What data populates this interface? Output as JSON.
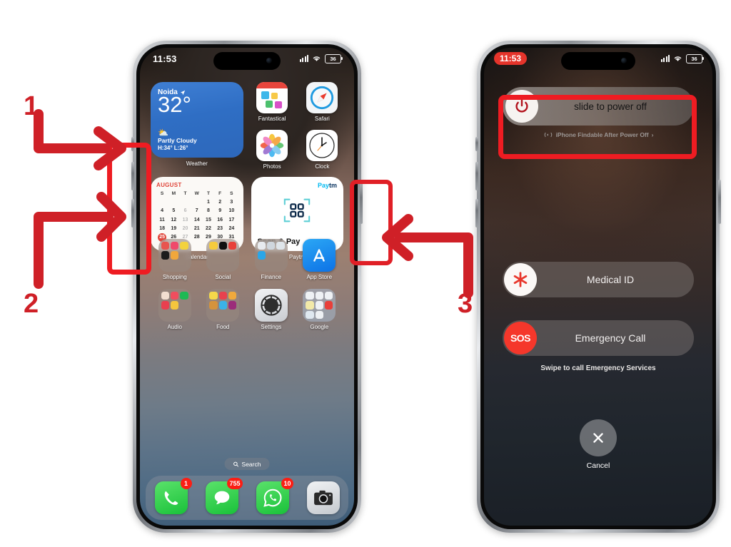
{
  "annotations": {
    "steps": [
      {
        "num": "1",
        "target": "volume-up-button"
      },
      {
        "num": "2",
        "target": "volume-down-button"
      },
      {
        "num": "3",
        "target": "side-power-button"
      }
    ]
  },
  "left_phone": {
    "status_bar": {
      "time": "11:53",
      "cellular": "signal-bars-icon",
      "wifi": "wifi-icon",
      "battery": "36"
    },
    "weather_widget": {
      "city": "Noida",
      "location_icon": "location-arrow-icon",
      "temperature": "32°",
      "condition_icon": "partly-cloudy-icon",
      "condition": "Partly Cloudy",
      "high_low": "H:34° L:26°",
      "caption": "Weather"
    },
    "top_apps": [
      {
        "label": "Fantastical",
        "icon": "fantastical-icon"
      },
      {
        "label": "Safari",
        "icon": "safari-icon"
      },
      {
        "label": "Photos",
        "icon": "photos-icon"
      },
      {
        "label": "Clock",
        "icon": "clock-icon"
      }
    ],
    "calendar_widget": {
      "month": "AUGUST",
      "caption": "Calendar",
      "today": "25",
      "dow": [
        "S",
        "M",
        "T",
        "W",
        "T",
        "F",
        "S"
      ],
      "cells": [
        {
          "d": "",
          "dim": true
        },
        {
          "d": "",
          "dim": true
        },
        {
          "d": "",
          "dim": true
        },
        {
          "d": "",
          "dim": true
        },
        {
          "d": "1"
        },
        {
          "d": "2"
        },
        {
          "d": "3"
        },
        {
          "d": "4"
        },
        {
          "d": "5"
        },
        {
          "d": "6",
          "dim": true
        },
        {
          "d": "7"
        },
        {
          "d": "8"
        },
        {
          "d": "9"
        },
        {
          "d": "10"
        },
        {
          "d": "11"
        },
        {
          "d": "12"
        },
        {
          "d": "13",
          "dim": true
        },
        {
          "d": "14"
        },
        {
          "d": "15"
        },
        {
          "d": "16"
        },
        {
          "d": "17"
        },
        {
          "d": "18"
        },
        {
          "d": "19"
        },
        {
          "d": "20",
          "dim": true
        },
        {
          "d": "21"
        },
        {
          "d": "22"
        },
        {
          "d": "23"
        },
        {
          "d": "24"
        },
        {
          "d": "25",
          "today": true
        },
        {
          "d": "26"
        },
        {
          "d": "27",
          "dim": true
        },
        {
          "d": "28"
        },
        {
          "d": "29"
        },
        {
          "d": "30"
        },
        {
          "d": "31"
        }
      ]
    },
    "paytm_widget": {
      "brand_part1": "Pay",
      "brand_part2": "tm",
      "title": "Scan & Pay",
      "qr_icon": "qr-scan-icon",
      "caption": "Paytm"
    },
    "folders": [
      {
        "label": "Shopping"
      },
      {
        "label": "Social"
      },
      {
        "label": "Finance"
      },
      {
        "label": "App Store",
        "single": true
      },
      {
        "label": "Audio"
      },
      {
        "label": "Food"
      },
      {
        "label": "Settings",
        "single": true
      },
      {
        "label": "Google"
      }
    ],
    "search": {
      "icon": "search-icon",
      "label": "Search"
    },
    "dock": [
      {
        "name": "phone-app",
        "badge": "1"
      },
      {
        "name": "messages-app",
        "badge": "755"
      },
      {
        "name": "whatsapp-app",
        "badge": "10"
      },
      {
        "name": "camera-app",
        "badge": ""
      }
    ]
  },
  "right_phone": {
    "status_bar": {
      "time": "11:53",
      "cellular": "signal-bars-icon",
      "wifi": "wifi-icon",
      "battery": "36"
    },
    "power_slider": {
      "icon": "power-icon",
      "label": "slide to power off"
    },
    "findable": {
      "icon": "findmy-waves-icon",
      "label": "iPhone Findable After Power Off",
      "chevron": "chevron-right-icon"
    },
    "medical_id": {
      "icon": "medical-asterisk-icon",
      "label": "Medical ID"
    },
    "emergency_call": {
      "icon": "SOS",
      "label": "Emergency Call"
    },
    "swipe_hint": "Swipe to call Emergency Services",
    "cancel": {
      "icon": "close-x-icon",
      "label": "Cancel"
    }
  },
  "colors": {
    "annotation_red": "#ee1c22",
    "number_red": "#cf2027",
    "badge_red": "#fb1e14",
    "sos_red": "#f5372b",
    "calendar_red": "#e0453a",
    "weather_blue": "#2f6ec4",
    "background": "#ffffff"
  }
}
